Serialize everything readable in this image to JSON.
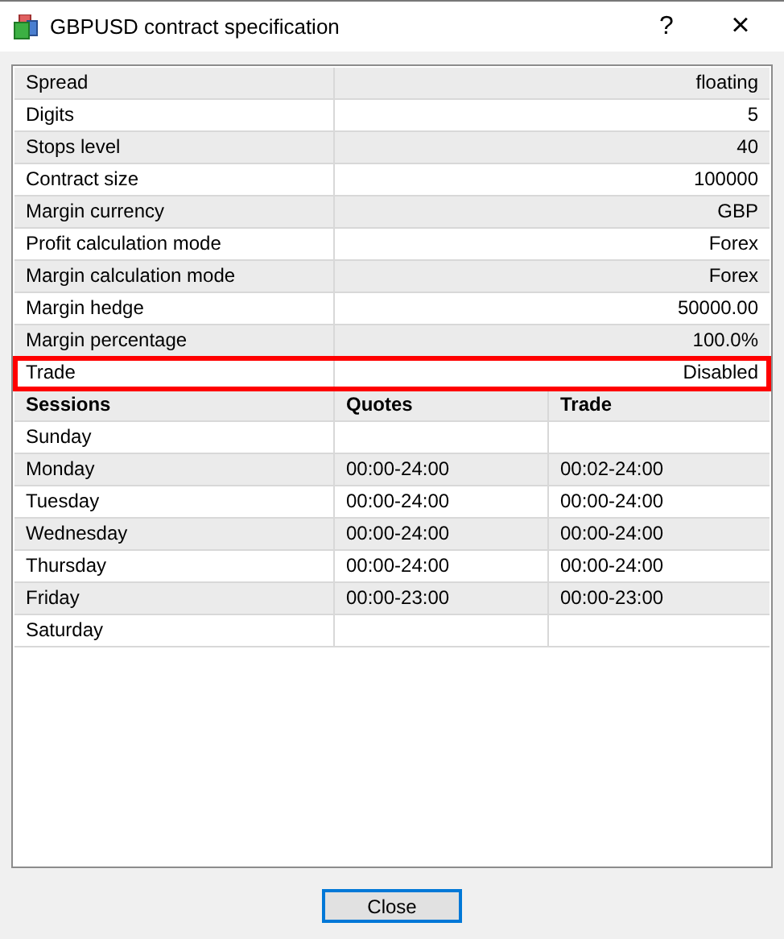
{
  "window": {
    "title": "GBPUSD contract specification",
    "help_button": "?",
    "close_button": "×"
  },
  "spec": [
    {
      "label": "Spread",
      "value": "floating",
      "highlighted": false
    },
    {
      "label": "Digits",
      "value": "5",
      "highlighted": false
    },
    {
      "label": "Stops level",
      "value": "40",
      "highlighted": false
    },
    {
      "label": "Contract size",
      "value": "100000",
      "highlighted": false
    },
    {
      "label": "Margin currency",
      "value": "GBP",
      "highlighted": false
    },
    {
      "label": "Profit calculation mode",
      "value": "Forex",
      "highlighted": false
    },
    {
      "label": "Margin calculation mode",
      "value": "Forex",
      "highlighted": false
    },
    {
      "label": "Margin hedge",
      "value": "50000.00",
      "highlighted": false
    },
    {
      "label": "Margin percentage",
      "value": "100.0%",
      "highlighted": false
    },
    {
      "label": "Trade",
      "value": "Disabled",
      "highlighted": true
    }
  ],
  "sessions": {
    "columns": [
      "Sessions",
      "Quotes",
      "Trade"
    ],
    "rows": [
      [
        "Sunday",
        "",
        ""
      ],
      [
        "Monday",
        "00:00-24:00",
        "00:02-24:00"
      ],
      [
        "Tuesday",
        "00:00-24:00",
        "00:00-24:00"
      ],
      [
        "Wednesday",
        "00:00-24:00",
        "00:00-24:00"
      ],
      [
        "Thursday",
        "00:00-24:00",
        "00:00-24:00"
      ],
      [
        "Friday",
        "00:00-23:00",
        "00:00-23:00"
      ],
      [
        "Saturday",
        "",
        ""
      ]
    ]
  },
  "buttons": [
    {
      "label": "Close",
      "focused": true
    }
  ]
}
